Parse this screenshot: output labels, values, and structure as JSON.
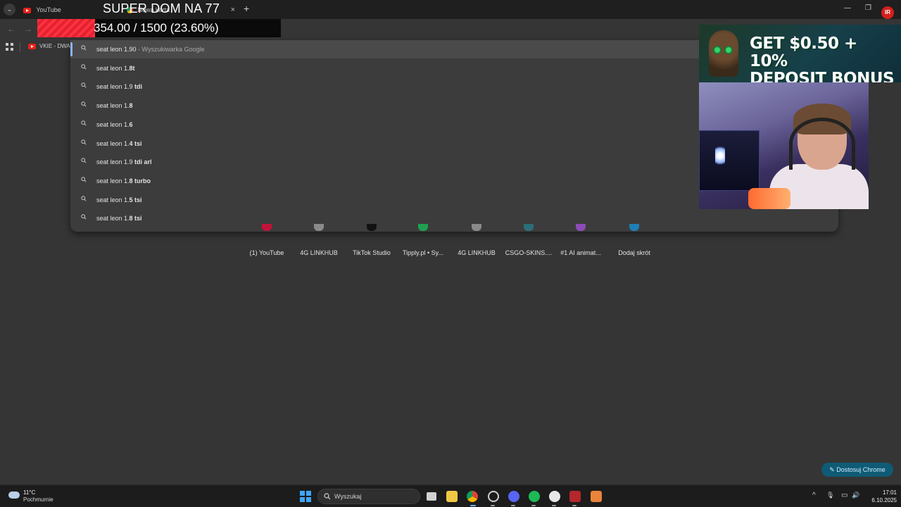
{
  "browser": {
    "tabs": [
      {
        "title": "YouTube",
        "icon": "youtube-icon"
      },
      {
        "title": "Nowa karta",
        "icon": "chrome-icon"
      }
    ],
    "tab_close": "×",
    "new_tab": "+",
    "window_controls": {
      "minimize": "—",
      "restore": "❐",
      "close": "✕"
    },
    "bookmarks": [
      {
        "label": "VKIE - DWA K"
      }
    ],
    "avatar_text": "IR"
  },
  "stream_overlay": {
    "title": "SUPER DOM NA 77",
    "progress_text": "354.00 / 1500 (23.60%)",
    "progress_fraction": 0.236,
    "progress_color": "#ff3040"
  },
  "omnibox": {
    "suggestions": [
      {
        "prefix": "seat leon 1.90",
        "bold": "",
        "hint": " - Wyszukiwarka Google"
      },
      {
        "prefix": "seat leon 1.",
        "bold": "8t",
        "hint": ""
      },
      {
        "prefix": "seat leon 1.9 ",
        "bold": "tdi",
        "hint": ""
      },
      {
        "prefix": "seat leon 1.",
        "bold": "8",
        "hint": ""
      },
      {
        "prefix": "seat leon 1.",
        "bold": "6",
        "hint": ""
      },
      {
        "prefix": "seat leon 1.",
        "bold": "4 tsi",
        "hint": ""
      },
      {
        "prefix": "seat leon 1.9 ",
        "bold": "tdi arl",
        "hint": ""
      },
      {
        "prefix": "seat leon 1.",
        "bold": "8 turbo",
        "hint": ""
      },
      {
        "prefix": "seat leon 1.",
        "bold": "5 tsi",
        "hint": ""
      },
      {
        "prefix": "seat leon 1.",
        "bold": "8 tsi",
        "hint": ""
      }
    ]
  },
  "shortcuts": [
    {
      "label": "(1) YouTube",
      "color": "#c4123a"
    },
    {
      "label": "4G LINKHUB",
      "color": "#8a8a8a"
    },
    {
      "label": "TikTok Studio",
      "color": "#111111"
    },
    {
      "label": "Tipply.pl • Sy...",
      "color": "#1fa050"
    },
    {
      "label": "4G LINKHUB",
      "color": "#8a8a8a"
    },
    {
      "label": "CSGO-SKINS....",
      "color": "#2b6f7a"
    },
    {
      "label": "#1 AI animat...",
      "color": "#8d4bb8"
    },
    {
      "label": "Dodaj skrót",
      "color": "#1f7fb5"
    }
  ],
  "ad": {
    "line1": "GET $0.50 + 10%",
    "line2": "DEPOSIT BONUS"
  },
  "customize_button": "Dostosuj Chrome",
  "taskbar": {
    "weather_temp": "11°C",
    "weather_desc": "Pochmurnie",
    "search_placeholder": "Wyszukaj",
    "apps": [
      "task-view-icon",
      "file-explorer-icon",
      "chrome-icon",
      "steam-icon",
      "discord-icon",
      "spotify-icon",
      "app-icon",
      "csgo-icon",
      "adobe-icon"
    ],
    "tray": {
      "chevron": "^",
      "mic": "🎙",
      "net": "▭",
      "vol": "🔊"
    },
    "time": "17:01",
    "date": "6.10.2025"
  }
}
